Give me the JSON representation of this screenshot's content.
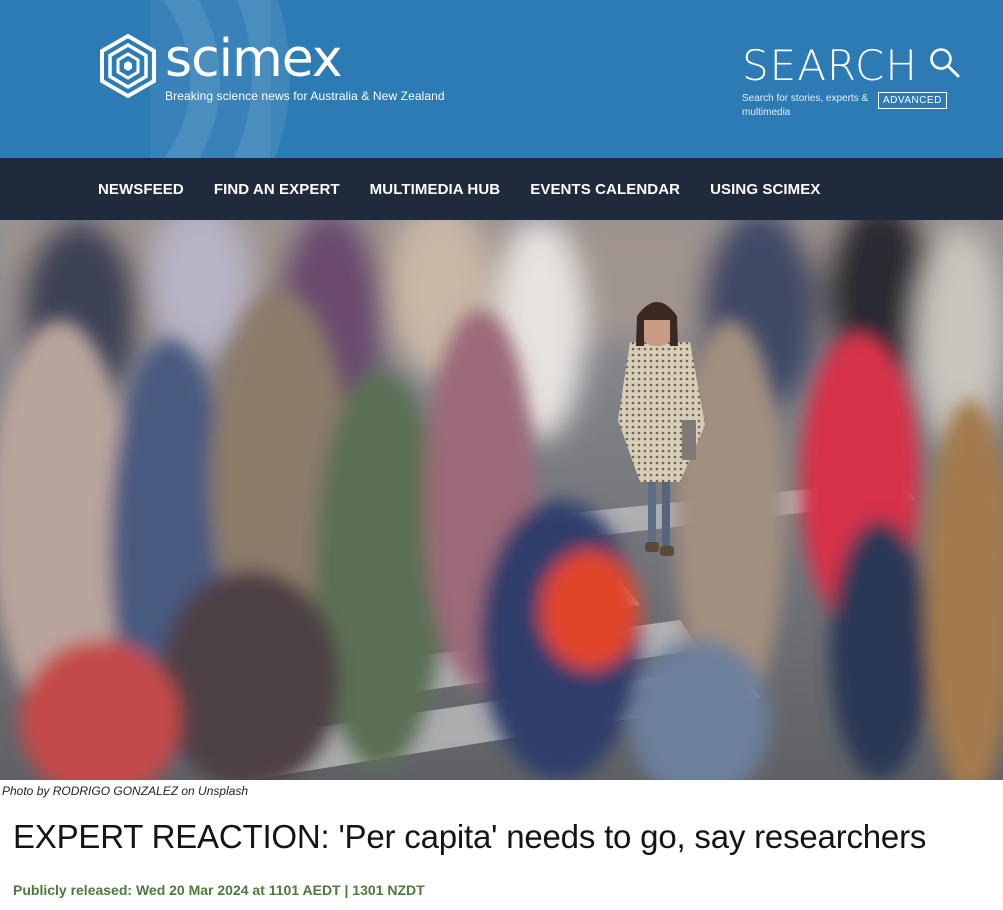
{
  "header": {
    "logo_word": "scimex",
    "tagline": "Breaking science news for Australia & New Zealand",
    "search_title": "SEARCH",
    "search_hint": "Search for stories, experts & multimedia",
    "advanced_label": "ADVANCED",
    "colors": {
      "header_bg": "#2c7bb5",
      "nav_bg": "#1f2b3d"
    }
  },
  "nav": {
    "items": [
      "NEWSFEED",
      "FIND AN EXPERT",
      "MULTIMEDIA HUB",
      "EVENTS CALENDAR",
      "USING SCIMEX"
    ]
  },
  "hero": {
    "caption": "Photo by RODRIGO GONZALEZ on Unsplash"
  },
  "article": {
    "title": "EXPERT REACTION: 'Per capita' needs to go, say researchers",
    "released": "Publicly released: Wed 20 Mar 2024 at 1101 AEDT | 1301 NZDT",
    "released_color": "#4b7a3c"
  },
  "icons": {
    "logo": "hexagon-logo-icon",
    "search": "search-icon"
  }
}
